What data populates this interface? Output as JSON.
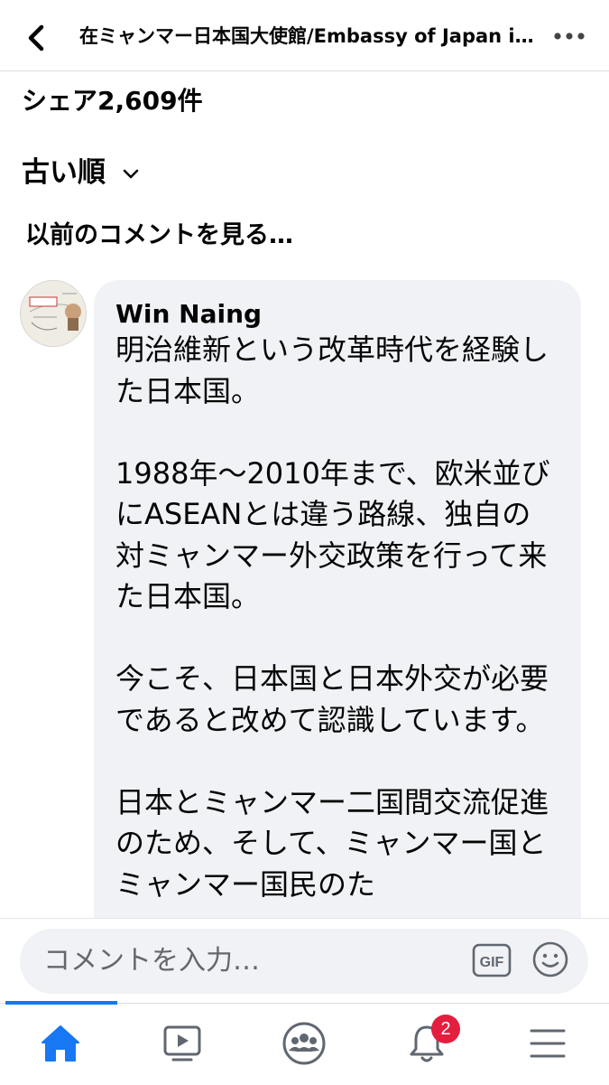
{
  "header": {
    "title": "在ミャンマー日本国大使館/Embassy of Japan in Myanmar",
    "back_icon": "chevron-left-icon",
    "more_icon": "more-horizontal-icon"
  },
  "share_count": "シェア2,609件",
  "sort": {
    "label": "古い順",
    "icon": "chevron-down-icon"
  },
  "previous_comments_link": "以前のコメントを見る…",
  "comment": {
    "author": "Win Naing",
    "avatar_icon": "profile-avatar",
    "paragraphs": [
      "明治維新という改革時代を経験した日本国。",
      "1988年～2010年まで、欧米並びにASEANとは違う路線、独自の対ミャンマー外交政策を行って来た日本国。",
      "今こそ、日本国と日本外交が必要であると改めて認識しています。",
      "日本とミャンマー二国間交流促進のため、そして、ミャンマー国とミャンマー国民のた"
    ]
  },
  "composer": {
    "placeholder": "コメントを入力…",
    "gif_label": "GIF",
    "emoji_icon": "emoji-smile-icon"
  },
  "tabbar": {
    "items": [
      "home-icon",
      "video-icon",
      "groups-icon",
      "notifications-icon",
      "menu-icon"
    ],
    "notification_badge": "2",
    "active_color": "#1877f2"
  }
}
